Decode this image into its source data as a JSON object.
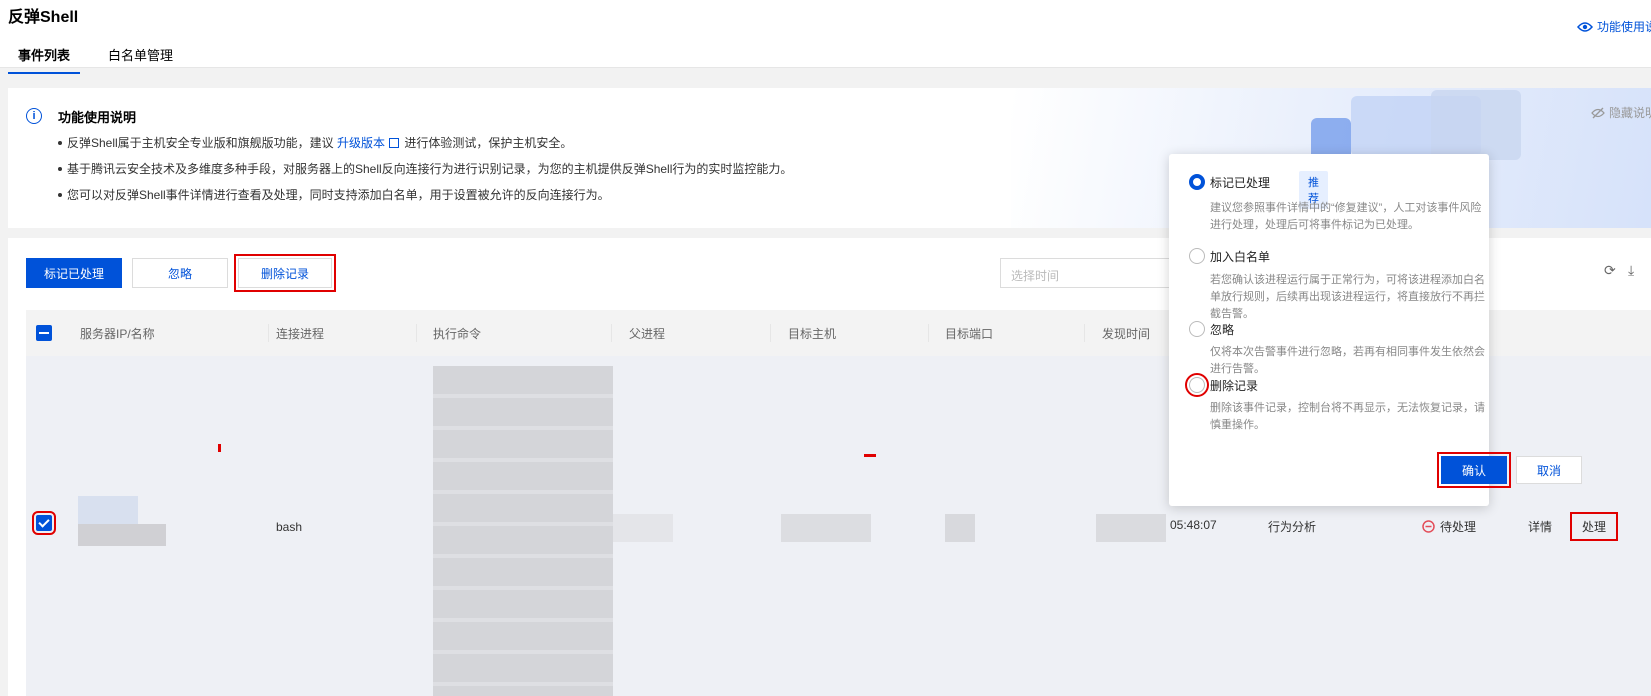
{
  "header": {
    "title": "反弹Shell",
    "help_link": "功能使用说",
    "tabs": [
      {
        "label": "事件列表",
        "active": true
      },
      {
        "label": "白名单管理",
        "active": false
      }
    ]
  },
  "info": {
    "title": "功能使用说明",
    "hide_label": "隐藏说明",
    "line1_prefix": "反弹Shell属于主机安全专业版和旗舰版功能，建议 ",
    "line1_link": "升级版本",
    "line1_suffix": " 进行体验测试，保护主机安全。",
    "line2": "基于腾讯云安全技术及多维度多种手段，对服务器上的Shell反向连接行为进行识别记录，为您的主机提供反弹Shell行为的实时监控能力。",
    "line3": "您可以对反弹Shell事件详情进行查看及处理，同时支持添加白名单，用于设置被允许的反向连接行为。"
  },
  "toolbar": {
    "mark_handled": "标记已处理",
    "ignore": "忽略",
    "delete_record": "删除记录",
    "date_placeholder": "选择时间"
  },
  "table": {
    "columns": [
      "服务器IP/名称",
      "连接进程",
      "执行命令",
      "父进程",
      "目标主机",
      "目标端口",
      "发现时间"
    ],
    "row": {
      "process": "bash",
      "time": "05:48:07",
      "source": "行为分析",
      "status": "待处理",
      "detail": "详情",
      "handle": "处理"
    }
  },
  "popover": {
    "options": [
      {
        "label": "标记已处理",
        "tag": "推荐",
        "desc": "建议您参照事件详情中的“修复建议”，人工对该事件风险进行处理，处理后可将事件标记为已处理。",
        "selected": true
      },
      {
        "label": "加入白名单",
        "desc": "若您确认该进程运行属于正常行为，可将该进程添加白名单放行规则，后续再出现该进程运行，将直接放行不再拦截告警。",
        "selected": false
      },
      {
        "label": "忽略",
        "desc": "仅将本次告警事件进行忽略，若再有相同事件发生依然会进行告警。",
        "selected": false
      },
      {
        "label": "删除记录",
        "desc": "删除该事件记录，控制台将不再显示，无法恢复记录，请慎重操作。",
        "selected": false
      }
    ],
    "confirm": "确认",
    "cancel": "取消"
  },
  "colors": {
    "brand": "#0052d9",
    "highlight": "#e00000",
    "status_pending": "#e34d59"
  }
}
